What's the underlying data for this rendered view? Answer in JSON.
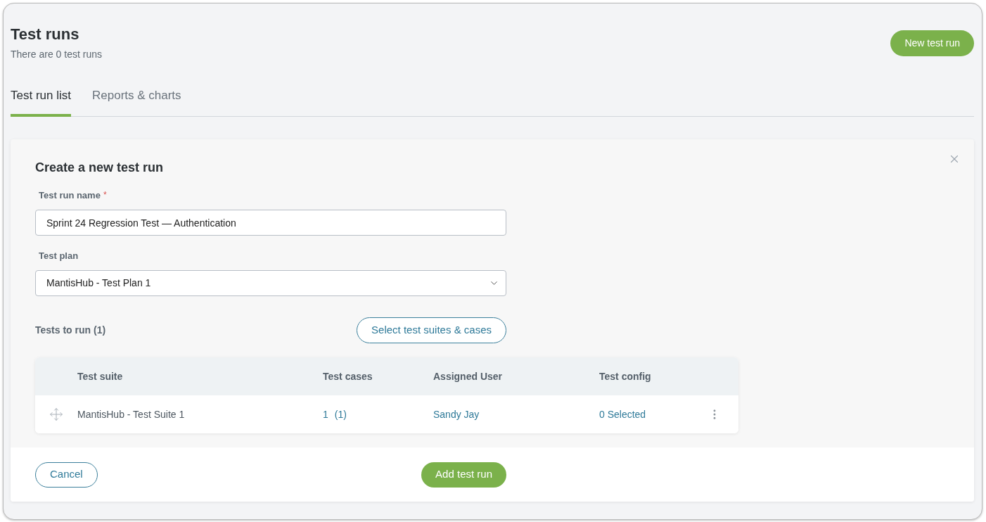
{
  "header": {
    "title": "Test runs",
    "subtitle": "There are 0 test runs",
    "new_button": "New test run"
  },
  "tabs": [
    {
      "label": "Test run list",
      "selected": true
    },
    {
      "label": "Reports & charts",
      "selected": false
    }
  ],
  "dialog": {
    "title": "Create a new test run",
    "fields": [
      {
        "kind": "text",
        "label": "Test run name",
        "required_mark": "*",
        "value": "Sprint 24 Regression Test — Authentication"
      },
      {
        "kind": "select",
        "label": "Test plan",
        "value": "MantisHub - Test Plan 1"
      }
    ],
    "tests_heading": "Tests to run (1)",
    "select_button": "Select test suites & cases",
    "table": {
      "columns": [
        "Test suite",
        "Test cases",
        "Assigned User",
        "Test config"
      ],
      "rows": [
        {
          "test_suite": "MantisHub - Test Suite 1",
          "test_cases": "1",
          "test_cases_total": "(1)",
          "assigned_user": "Sandy Jay",
          "test_config": "0 Selected"
        }
      ]
    },
    "buttons": [
      {
        "kind": "secondary",
        "label": "Cancel"
      },
      {
        "kind": "primary",
        "label": "Add test run"
      }
    ]
  }
}
